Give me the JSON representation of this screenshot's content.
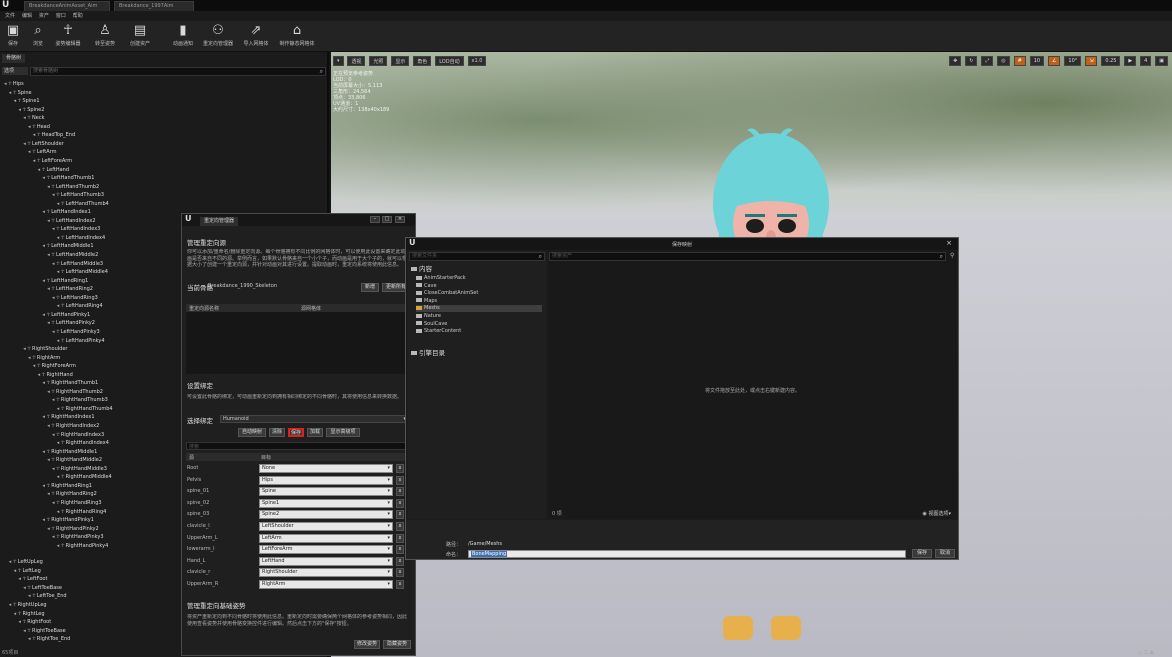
{
  "window": {
    "tabs": [
      "BreakdanceAnimAsset_Aim",
      "Breakdance_1997Aim"
    ]
  },
  "menu": [
    "文件",
    "编辑",
    "资产",
    "窗口",
    "帮助"
  ],
  "toolbar": [
    {
      "label": "保存",
      "icon": "save-icon"
    },
    {
      "label": "浏览",
      "icon": "browse-icon"
    },
    {
      "label": "姿势编辑器",
      "icon": "pose-icon"
    },
    {
      "label": "转至姿势",
      "icon": "retarget-pose-icon"
    },
    {
      "label": "创建资产",
      "icon": "create-asset-icon"
    },
    {
      "label": "动画通知",
      "icon": "anim-notify-icon"
    },
    {
      "label": "重定向管理器",
      "icon": "retarget-manager-icon"
    },
    {
      "label": "导入网格体",
      "icon": "import-mesh-icon"
    },
    {
      "label": "制作静态网格体",
      "icon": "make-static-mesh-icon"
    }
  ],
  "left_panel": {
    "tab": "骨骼树",
    "options": "选项",
    "search_placeholder": "搜索骨骼树",
    "bones": [
      "Hips",
      "Spine",
      "Spine1",
      "Spine2",
      "Neck",
      "Head",
      "HeadTop_End",
      "LeftShoulder",
      "LeftArm",
      "LeftForeArm",
      "LeftHand",
      "LeftHandThumb1",
      "LeftHandThumb2",
      "LeftHandThumb3",
      "LeftHandThumb4",
      "LeftHandIndex1",
      "LeftHandIndex2",
      "LeftHandIndex3",
      "LeftHandIndex4",
      "LeftHandMiddle1",
      "LeftHandMiddle2",
      "LeftHandMiddle3",
      "LeftHandMiddle4",
      "LeftHandRing1",
      "LeftHandRing2",
      "LeftHandRing3",
      "LeftHandRing4",
      "LeftHandPinky1",
      "LeftHandPinky2",
      "LeftHandPinky3",
      "LeftHandPinky4",
      "RightShoulder",
      "RightArm",
      "RightForeArm",
      "RightHand",
      "RightHandThumb1",
      "RightHandThumb2",
      "RightHandThumb3",
      "RightHandThumb4",
      "RightHandIndex1",
      "RightHandIndex2",
      "RightHandIndex3",
      "RightHandIndex4",
      "RightHandMiddle1",
      "RightHandMiddle2",
      "RightHandMiddle3",
      "RightHandMiddle4",
      "RightHandRing1",
      "RightHandRing2",
      "RightHandRing3",
      "RightHandRing4",
      "RightHandPinky1",
      "RightHandPinky2",
      "RightHandPinky3",
      "RightHandPinky4",
      "LeftUpLeg",
      "LeftLeg",
      "LeftFoot",
      "LeftToeBase",
      "LeftToe_End",
      "RightUpLeg",
      "RightLeg",
      "RightFoot",
      "RightToeBase",
      "RightToe_End"
    ],
    "footer": "65项目"
  },
  "viewport": {
    "tools": [
      "透视",
      "光照",
      "显示",
      "角色",
      "LOD自动",
      "x1.0"
    ],
    "right_tools": [
      "10",
      "10°",
      "0.25",
      "4"
    ],
    "stats": [
      "正在预览参考姿势",
      "LOD：0",
      "当前屏幕大小：5.113",
      "三角形：24,564",
      "顶点：33,806",
      "UV通道：1",
      "大约尺寸：138x40x189"
    ]
  },
  "retarget_manager": {
    "tab": "重定向管理器",
    "section1_title": "管理重定向源",
    "section1_text": "你可以添加/重命名/删除重定向源。每个骨骼拥有不同比例的网格体时，可以使用此设置来确定此动画是否来自不同的源。举例而言，如果默认骨骼来自一个小个子，而动画是用于大个子的，就可以根据大小了创建一个重定向源，并针对动画对其进行设置。提取动画时，重定向系统将使用此信息。",
    "current_bone_label": "当前骨骼",
    "current_bone_value": "Breakdance_1990_Skeleton",
    "btn_new": "新增",
    "btn_update": "更新所有",
    "list_col1": "重定向源名称",
    "list_col2": "源网格体",
    "section2_title": "设置绑定",
    "section2_text": "可设置此骨骼的绑定，可动画重新定向到拥有相同绑定的不同骨骼时，其将使用信息来转换数据。",
    "select_rig_label": "选择绑定",
    "select_rig_value": "Humanoid",
    "btn_auto": "自动映射",
    "btn_clear": "清除",
    "btn_save": "保存",
    "btn_load": "加载",
    "btn_show_adv": "显示高级项",
    "map_search": "搜索",
    "map_col1": "源",
    "map_col2": "目标",
    "mappings": [
      {
        "source": "Root",
        "target": "None"
      },
      {
        "source": "Pelvis",
        "target": "Hips"
      },
      {
        "source": "spine_01",
        "target": "Spine"
      },
      {
        "source": "spine_02",
        "target": "Spine1"
      },
      {
        "source": "spine_03",
        "target": "Spine2"
      },
      {
        "source": "clavicle_l",
        "target": "LeftShoulder"
      },
      {
        "source": "UpperArm_L",
        "target": "LeftArm"
      },
      {
        "source": "lowerarm_l",
        "target": "LeftForeArm"
      },
      {
        "source": "Hand_L",
        "target": "LeftHand"
      },
      {
        "source": "clavicle_r",
        "target": "RightShoulder"
      },
      {
        "source": "UpperArm_R",
        "target": "RightArm"
      }
    ],
    "section3_title": "管理重定向基础姿势",
    "section3_text": "将资产重新定向到不同骨骼时将使用此信息。重新定向时需要确保两个网格体的参考姿势相同，因此使用查看姿势并使用骨骼变换控件进行编辑。然后点击下方的\"保存\"按钮。",
    "btn_modify_pose": "修改姿势",
    "btn_hide_pose": "隐藏姿势"
  },
  "save_dialog": {
    "title": "保存映射",
    "search_folders": "搜索文件夹",
    "search_assets": "搜索资产",
    "root_folder": "内容",
    "folders": [
      "AnimStarterPack",
      "Cave",
      "CloseCombatAnimSet",
      "Maps",
      "Meshs",
      "Nature",
      "SoulCave",
      "StarterContent"
    ],
    "selected_folder": "Meshs",
    "engine_folder": "引擎目录",
    "empty_message": "将文件拖放至此处，或点击右键新建内容。",
    "item_count": "0 项",
    "view_options": "视图选项",
    "path_label": "路径：",
    "path_value": "/Game/Meshs",
    "name_label": "命名：",
    "name_value": "BoneMapping",
    "btn_save": "保存",
    "btn_cancel": "取消"
  }
}
